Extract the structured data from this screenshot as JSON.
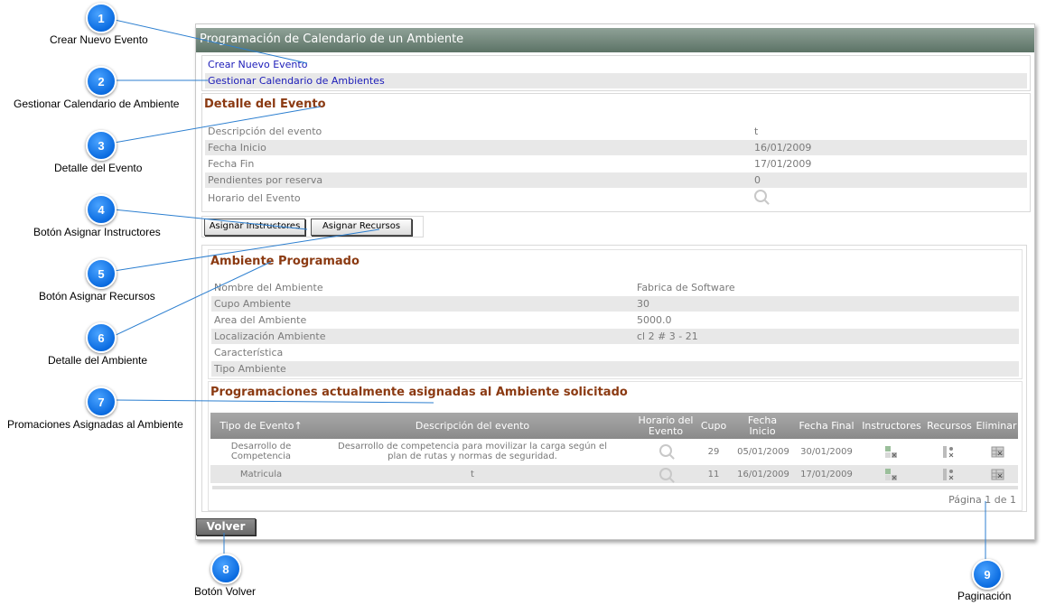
{
  "window": {
    "title": "Programación de Calendario de un Ambiente"
  },
  "links": {
    "crear": "Crear Nuevo Evento",
    "gestionar": "Gestionar Calendario de Ambientes"
  },
  "evento": {
    "title": "Detalle del Evento",
    "rows": [
      {
        "label": "Descripción del evento",
        "value": "t"
      },
      {
        "label": "Fecha Inicio",
        "value": "16/01/2009"
      },
      {
        "label": "Fecha Fin",
        "value": "17/01/2009"
      },
      {
        "label": "Pendientes por reserva",
        "value": "0"
      },
      {
        "label": "Horario del Evento",
        "value": ""
      }
    ]
  },
  "buttons": {
    "instructores": "Asignar Instructores",
    "recursos": "Asignar Recursos",
    "volver": "Volver"
  },
  "ambiente": {
    "title": "Ambiente Programado",
    "rows": [
      {
        "label": "Nombre del Ambiente",
        "value": "Fabrica de Software"
      },
      {
        "label": "Cupo Ambiente",
        "value": "30"
      },
      {
        "label": "Area del Ambiente",
        "value": "5000.0"
      },
      {
        "label": "Localización Ambiente",
        "value": "cl 2 # 3 - 21"
      },
      {
        "label": "Característica",
        "value": ""
      },
      {
        "label": "Tipo Ambiente",
        "value": ""
      }
    ]
  },
  "programaciones": {
    "title": "Programaciones actualmente asignadas al Ambiente solicitado",
    "headers": {
      "tipo": "Tipo de Evento↑",
      "descripcion": "Descripción del evento",
      "horario_1": "Horario del",
      "horario_2": "Evento",
      "cupo": "Cupo",
      "fecha_inicio_1": "Fecha",
      "fecha_inicio_2": "Inicio",
      "fecha_final": "Fecha Final",
      "instructores": "Instructores",
      "recursos": "Recursos",
      "eliminar": "Eliminar"
    },
    "rows": [
      {
        "tipo_1": "Desarrollo de",
        "tipo_2": "Competencia",
        "desc_1": "Desarrollo de competencia para movilizar la carga según el",
        "desc_2": "plan de rutas y normas de seguridad.",
        "cupo": "29",
        "inicio": "05/01/2009",
        "final": "30/01/2009"
      },
      {
        "tipo_1": "Matricula",
        "tipo_2": "",
        "desc_1": "t",
        "desc_2": "",
        "cupo": "11",
        "inicio": "16/01/2009",
        "final": "17/01/2009"
      }
    ],
    "pagination": "Página 1 de 1"
  },
  "callouts": [
    {
      "n": "1",
      "label": "Crear Nuevo Evento"
    },
    {
      "n": "2",
      "label": "Gestionar Calendario de Ambiente"
    },
    {
      "n": "3",
      "label": "Detalle del Evento"
    },
    {
      "n": "4",
      "label": "Botón Asignar Instructores"
    },
    {
      "n": "5",
      "label": "Botón Asignar Recursos"
    },
    {
      "n": "6",
      "label": "Detalle del Ambiente"
    },
    {
      "n": "7",
      "label": "Promaciones Asignadas al Ambiente"
    },
    {
      "n": "8",
      "label": "Botón Volver"
    },
    {
      "n": "9",
      "label": "Paginación"
    }
  ],
  "icons": {
    "search": "magnifier-icon",
    "instructores": "assign-instructor-icon",
    "recursos": "assign-resource-icon",
    "eliminar": "delete-grid-icon"
  },
  "colors": {
    "callout": "#0a6be0",
    "titlebar": "#6a7f72",
    "section_title": "#8b3a12",
    "link": "#1b1bb8"
  }
}
